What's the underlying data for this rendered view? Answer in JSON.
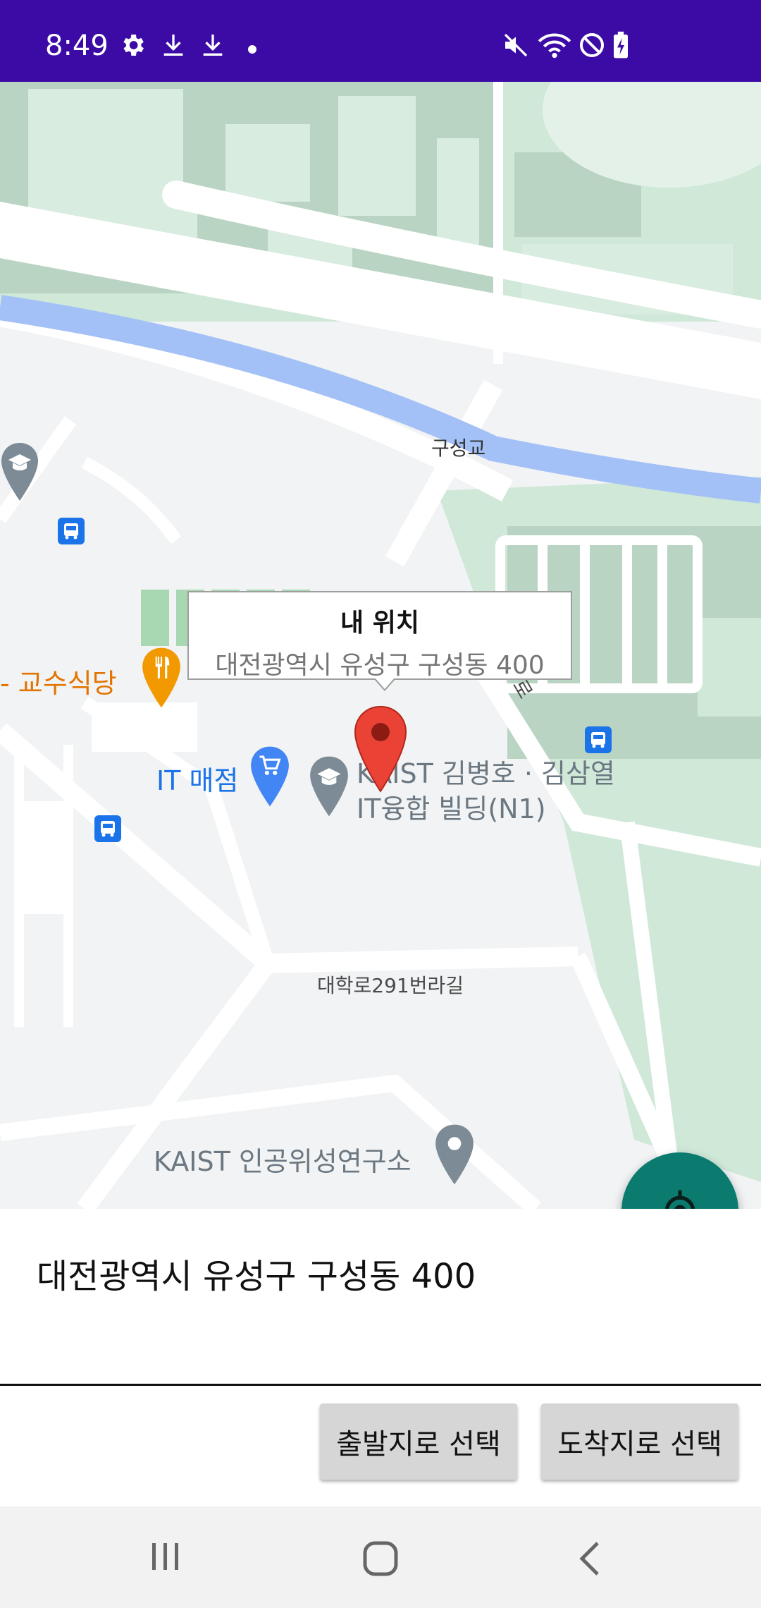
{
  "status_bar": {
    "time": "8:49",
    "left_icons": [
      "settings-icon",
      "download-icon",
      "download-icon",
      "dot-icon"
    ],
    "right_icons": [
      "mute-icon",
      "wifi-icon",
      "do-not-disturb-icon",
      "battery-charging-icon"
    ],
    "background": "#3c0aa5"
  },
  "map": {
    "labels": {
      "bridge": "구성교",
      "partial_road": "로",
      "cafeteria": "- 교수식당",
      "store": "IT 매점",
      "building_line1": "KAIST 김병호 · 김삼열",
      "building_line2": "IT융합 빌딩(N1)",
      "street": "대학로291번라길",
      "institute": "KAIST 인공위성연구소"
    },
    "info_window": {
      "title": "내 위치",
      "snippet": "대전광역시 유성구 구성동 400"
    },
    "marker_icon": "red-location-pin-icon",
    "locate_button_icon": "my-location-crosshair-icon"
  },
  "address": "대전광역시 유성구 구성동 400",
  "buttons": {
    "start": "출발지로 선택",
    "destination": "도착지로 선택"
  },
  "nav_bar": {
    "icons": [
      "recent-apps-icon",
      "home-icon",
      "back-icon"
    ]
  },
  "colors": {
    "accent_fab": "#0b7b6f",
    "marker": "#ea4335",
    "poi_blue": "#1a73e8",
    "poi_orange": "#e37400"
  }
}
